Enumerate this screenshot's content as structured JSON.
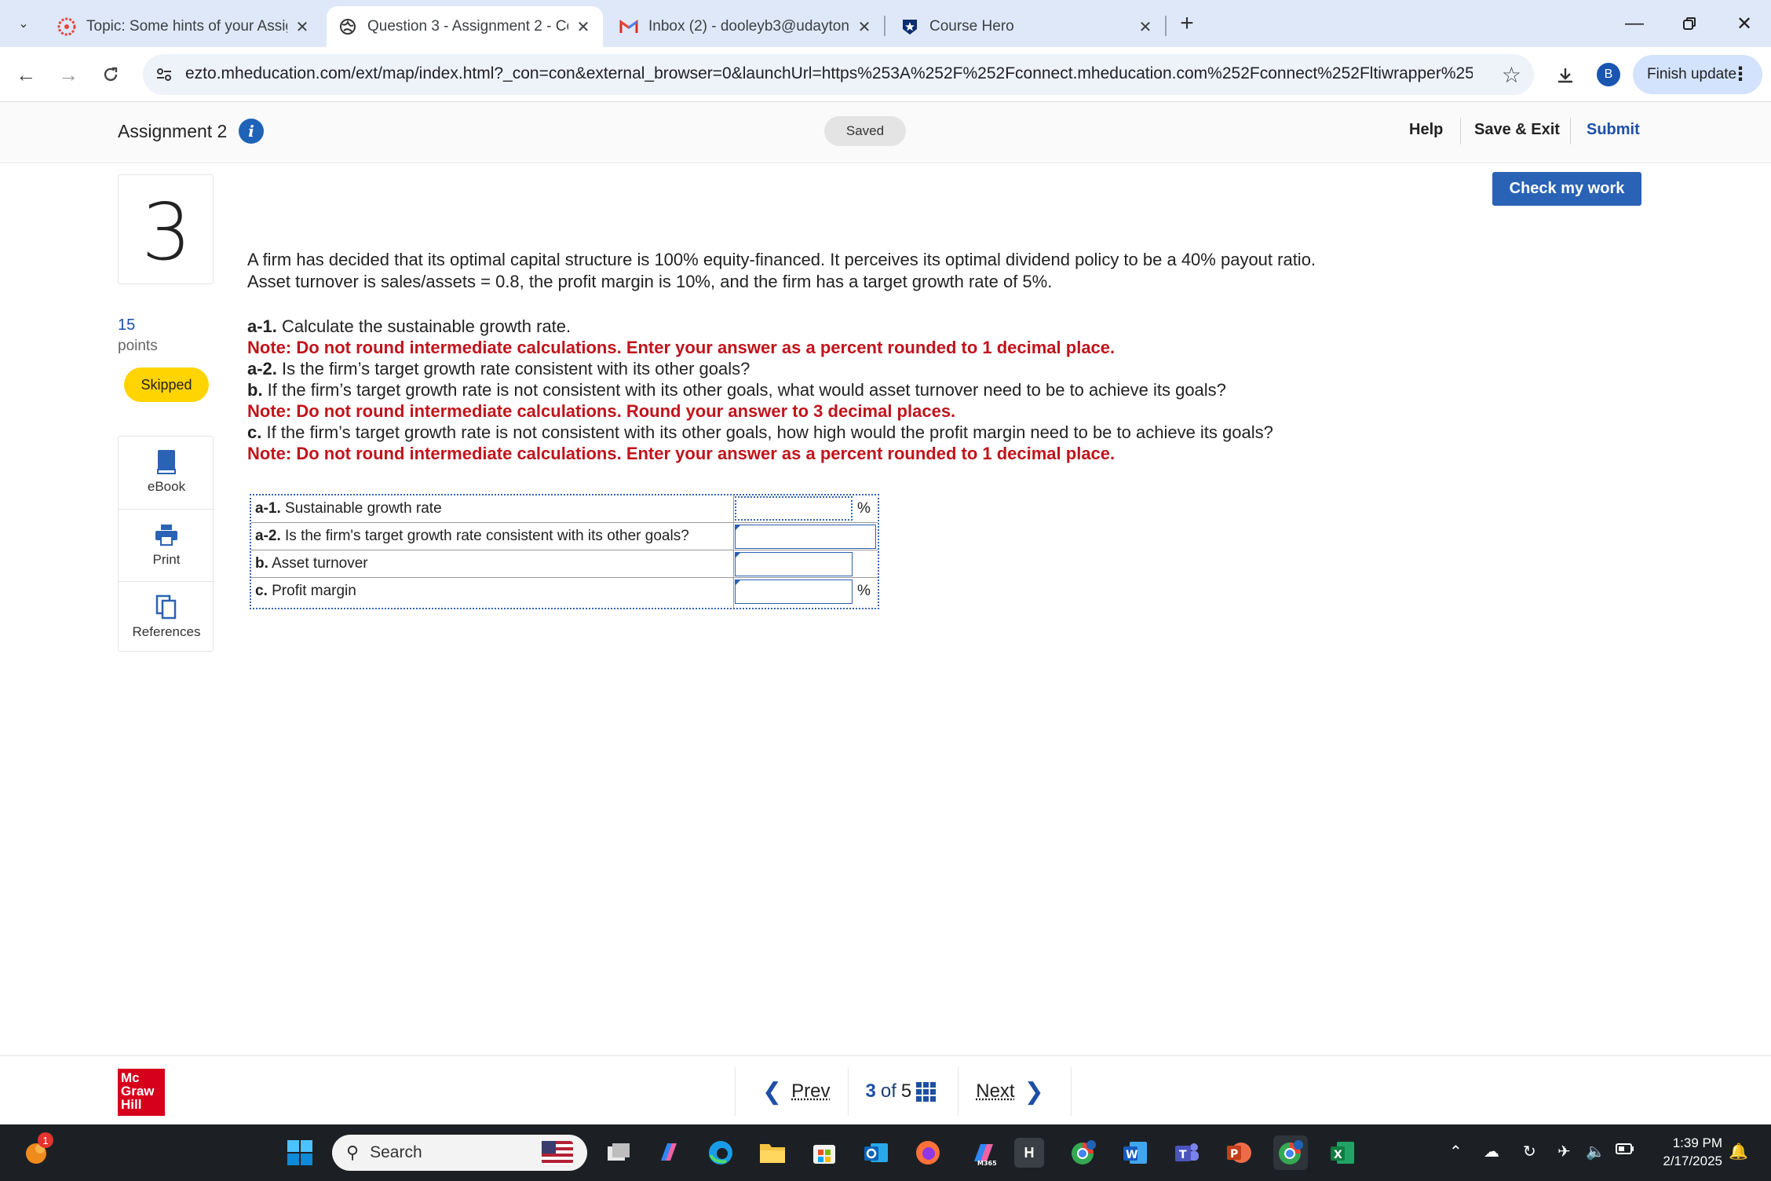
{
  "browser": {
    "tabs": [
      {
        "title": "Topic: Some hints of your Assig",
        "icon": "canvas-icon"
      },
      {
        "title": "Question 3 - Assignment 2 - Co",
        "icon": "globe-icon"
      },
      {
        "title": "Inbox (2) - dooleyb3@udayton.",
        "icon": "gmail-icon"
      },
      {
        "title": "Course Hero",
        "icon": "coursehero-icon"
      }
    ],
    "url": "ezto.mheducation.com/ext/map/index.html?_con=con&external_browser=0&launchUrl=https%253A%252F%252Fconnect.mheducation.com%252Fconnect%252Fltiwrapper%25...",
    "avatar_letter": "B",
    "finish_update_label": "Finish update"
  },
  "header": {
    "assignment_title": "Assignment 2",
    "saved_label": "Saved",
    "help_label": "Help",
    "save_exit_label": "Save & Exit",
    "submit_label": "Submit",
    "check_label": "Check my work"
  },
  "question": {
    "number": "3",
    "points": "15",
    "points_label": "points",
    "status": "Skipped",
    "stem": "A firm has decided that its optimal capital structure is 100% equity-financed. It perceives its optimal dividend policy to be a 40% payout ratio. Asset turnover is sales/assets = 0.8, the profit margin is 10%, and the firm has a target growth rate of 5%.",
    "parts": {
      "a1_tag": "a-1.",
      "a1_text": " Calculate the sustainable growth rate.",
      "a1_note": "Note: Do not round intermediate calculations. Enter your answer as a percent rounded to 1 decimal place.",
      "a2_tag": "a-2.",
      "a2_text": " Is the firm’s target growth rate consistent with its other goals?",
      "b_tag": "b.",
      "b_text": " If the firm’s target growth rate is not consistent with its other goals, what would asset turnover need to be to achieve its goals?",
      "b_note": "Note: Do not round intermediate calculations. Round your answer to 3 decimal places.",
      "c_tag": "c.",
      "c_text": " If the firm’s target growth rate is not consistent with its other goals, how high would the profit margin need to be to achieve its goals?",
      "c_note": "Note: Do not round intermediate calculations. Enter your answer as a percent rounded to 1 decimal place."
    }
  },
  "tools": {
    "ebook": "eBook",
    "print": "Print",
    "references": "References"
  },
  "answer_table": {
    "rows": [
      {
        "tag": "a-1.",
        "label": " Sustainable growth rate",
        "value": "",
        "unit": "%"
      },
      {
        "tag": "a-2.",
        "label": " Is the firm's target growth rate consistent with its other goals?",
        "value": "",
        "unit": ""
      },
      {
        "tag": "b.",
        "label": " Asset turnover",
        "value": "",
        "unit": ""
      },
      {
        "tag": "c.",
        "label": " Profit margin",
        "value": "",
        "unit": "%"
      }
    ]
  },
  "footer": {
    "logo_lines": [
      "Mc",
      "Graw",
      "Hill"
    ],
    "prev_label": "Prev",
    "current": "3",
    "of_label": "of",
    "total": "5",
    "next_label": "Next"
  },
  "taskbar": {
    "search_placeholder": "Search",
    "time": "1:39 PM",
    "date": "2/17/2025",
    "notification_count": "1"
  }
}
